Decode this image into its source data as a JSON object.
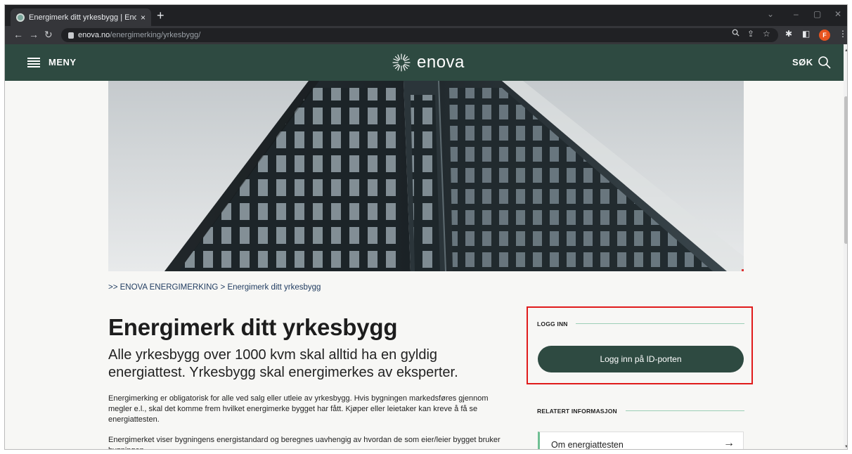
{
  "browser": {
    "tab_title": "Energimerk ditt yrkesbygg | Eno",
    "tab_close": "×",
    "new_tab": "+",
    "url_host": "enova.no",
    "url_path": "/energimerking/yrkesbygg/",
    "avatar_letter": "F"
  },
  "header": {
    "menu_label": "MENY",
    "logo_text": "enova",
    "search_label": "SØK"
  },
  "breadcrumb": ">> ENOVA ENERGIMERKING > Energimerk ditt yrkesbygg",
  "main": {
    "title": "Energimerk ditt yrkesbygg",
    "lead": "Alle yrkesbygg over 1000 kvm skal alltid ha en gyldig energiattest. Yrkesbygg skal energimerkes av eksperter.",
    "paragraph1": "Energimerking er obligatorisk for alle ved salg eller utleie av yrkesbygg. Hvis bygningen markedsføres gjennom megler e.l., skal det komme frem hvilket energimerke bygget har fått. Kjøper eller leietaker kan kreve å få se energiattesten.",
    "paragraph2": "Energimerket viser bygningens energistandard og beregnes uavhengig av hvordan de som eier/leier bygget bruker bygningen."
  },
  "sidebar": {
    "login_heading": "LOGG INN",
    "login_button": "Logg inn på ID-porten",
    "related_heading": "RELATERT INFORMASJON",
    "related_items": [
      {
        "label": "Om energiattesten",
        "arrow": "→"
      }
    ]
  },
  "colors": {
    "brand_dark_green": "#2e4a41",
    "accent_mint": "#9ccfb6",
    "highlight_red": "#e01b1b"
  },
  "icons": {
    "hamburger": "hamburger-menu-icon",
    "search": "search-icon",
    "logo": "enova-starburst-icon",
    "arrow": "arrow-right-icon"
  }
}
